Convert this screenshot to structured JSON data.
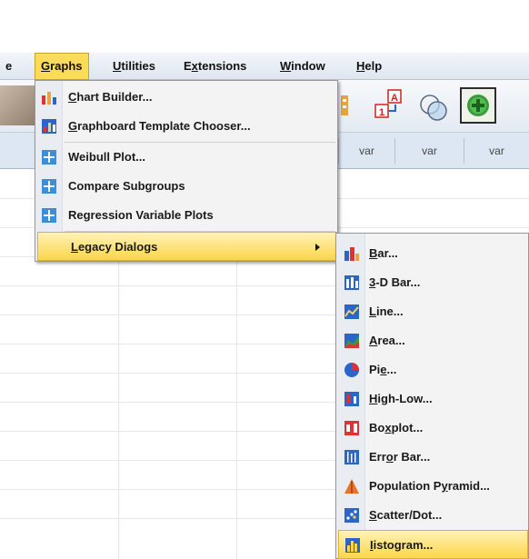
{
  "menubar": {
    "items": [
      {
        "label": "e"
      },
      {
        "label": "Graphs",
        "underline": "G",
        "rest": "raphs"
      },
      {
        "label": "Utilities",
        "underline": "U",
        "rest": "tilities"
      },
      {
        "label": "Extensions",
        "pre": "E",
        "underline": "x",
        "rest": "tensions"
      },
      {
        "label": "Window",
        "underline": "W",
        "rest": "indow"
      },
      {
        "label": "Help",
        "underline": "H",
        "rest": "elp"
      }
    ]
  },
  "grid": {
    "columns": [
      "var",
      "var",
      "var"
    ]
  },
  "graphs_menu": {
    "items": [
      {
        "label": "Chart Builder...",
        "underline": "C",
        "rest": "hart Builder...",
        "icon": "chart-builder-icon"
      },
      {
        "label": "Graphboard Template Chooser...",
        "underline": "G",
        "rest": "raphboard Template Chooser...",
        "icon": "graphboard-icon"
      },
      {
        "label": "Weibull Plot...",
        "icon": "weibull-plot-icon"
      },
      {
        "label": "Compare Subgroups",
        "icon": "compare-subgroups-icon"
      },
      {
        "label": "Regression Variable Plots",
        "icon": "regression-plots-icon"
      },
      {
        "label": "Legacy Dialogs",
        "underline": "L",
        "rest": "egacy Dialogs",
        "has_submenu": true
      }
    ]
  },
  "legacy_submenu": {
    "items": [
      {
        "pre": "",
        "underline": "B",
        "rest": "ar...",
        "icon": "bar-chart-icon"
      },
      {
        "pre": "",
        "underline": "3",
        "rest": "-D Bar...",
        "icon": "3d-bar-icon"
      },
      {
        "pre": "",
        "underline": "L",
        "rest": "ine...",
        "icon": "line-chart-icon"
      },
      {
        "pre": "",
        "underline": "A",
        "rest": "rea...",
        "icon": "area-chart-icon"
      },
      {
        "pre": "Pi",
        "underline": "e",
        "rest": "...",
        "icon": "pie-chart-icon"
      },
      {
        "pre": "",
        "underline": "H",
        "rest": "igh-Low...",
        "icon": "high-low-icon"
      },
      {
        "pre": "Bo",
        "underline": "x",
        "rest": "plot...",
        "icon": "boxplot-icon"
      },
      {
        "pre": "Err",
        "underline": "o",
        "rest": "r Bar...",
        "icon": "error-bar-icon"
      },
      {
        "pre": "Population P",
        "underline": "y",
        "rest": "ramid...",
        "icon": "population-pyramid-icon"
      },
      {
        "pre": "",
        "underline": "S",
        "rest": "catter/Dot...",
        "icon": "scatter-dot-icon"
      },
      {
        "pre": "",
        "underline": "I",
        "rest": "istogram...",
        "icon": "histogram-icon"
      }
    ]
  },
  "colors": {
    "highlight": "#fbd64a",
    "menubar": "#dfe6f0",
    "grid_header": "#dde7f3"
  }
}
